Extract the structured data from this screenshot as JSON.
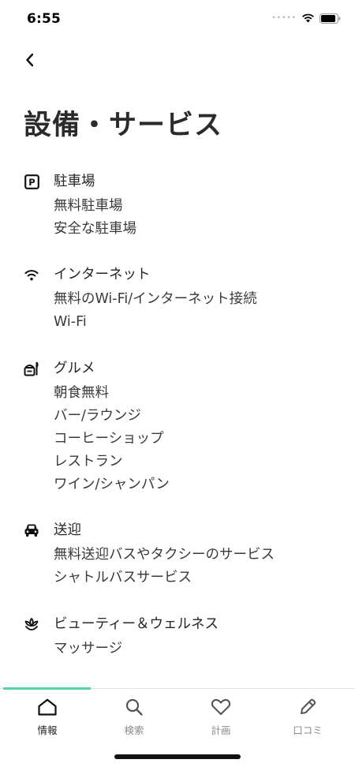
{
  "status_bar": {
    "time": "6:55",
    "signal": "•••••",
    "icons": [
      "wifi-icon",
      "battery-icon"
    ]
  },
  "header": {
    "back_icon": "chevron-left-icon",
    "title": "設備・サービス"
  },
  "sections": [
    {
      "icon": "parking-icon",
      "icon_glyph": "P",
      "heading": "駐車場",
      "items": [
        "無料駐車場",
        "安全な駐車場"
      ]
    },
    {
      "icon": "wifi-icon",
      "heading": "インターネット",
      "items": [
        "無料のWi-Fi/インターネット接続",
        "Wi-Fi"
      ]
    },
    {
      "icon": "dining-icon",
      "heading": "グルメ",
      "items": [
        "朝食無料",
        "バー/ラウンジ",
        "コーヒーショップ",
        "レストラン",
        "ワイン/シャンパン"
      ]
    },
    {
      "icon": "car-icon",
      "heading": "送迎",
      "items": [
        "無料送迎バスやタクシーのサービス",
        "シャトルバスサービス"
      ]
    },
    {
      "icon": "lotus-icon",
      "heading": "ビューティー＆ウェルネス",
      "items": [
        "マッサージ"
      ]
    }
  ],
  "tabbar": {
    "active_color": "#52d4a3",
    "tabs": [
      {
        "icon": "home-icon",
        "label": "情報",
        "active": true
      },
      {
        "icon": "search-icon",
        "label": "検索",
        "active": false
      },
      {
        "icon": "heart-icon",
        "label": "計画",
        "active": false
      },
      {
        "icon": "pencil-icon",
        "label": "口コミ",
        "active": false
      }
    ]
  }
}
